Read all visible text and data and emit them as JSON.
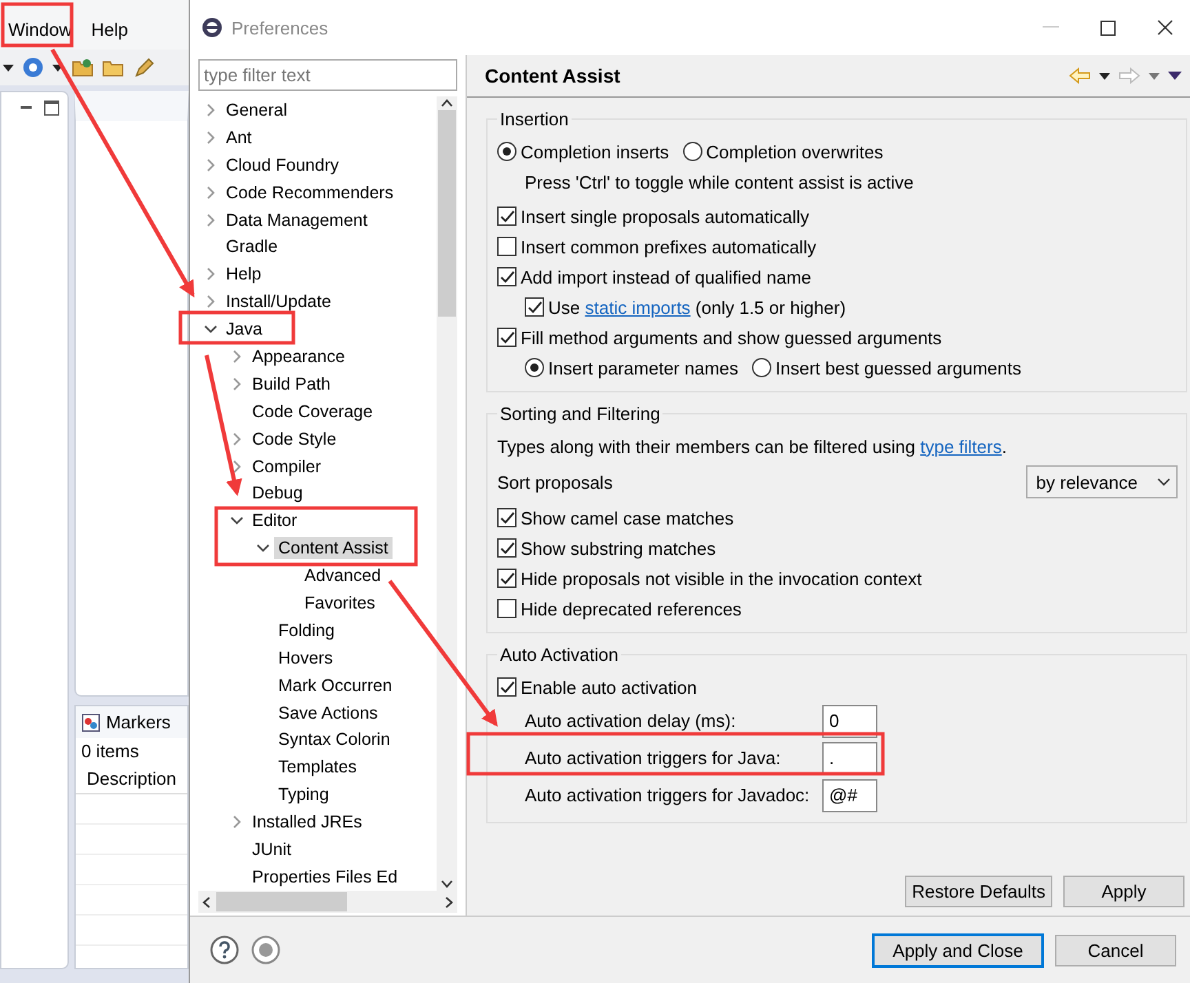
{
  "workbench": {
    "menu": [
      "Window",
      "Help"
    ],
    "markers_view": {
      "title": "Markers",
      "count": "0 items",
      "columns": [
        "Description"
      ]
    }
  },
  "dialog": {
    "title": "Preferences",
    "filter": {
      "placeholder": "type filter text"
    },
    "tree": [
      {
        "label": "General",
        "kind": "folder",
        "expanded": false,
        "selected": false
      },
      {
        "label": "Ant",
        "kind": "folder",
        "expanded": false,
        "selected": false
      },
      {
        "label": "Cloud Foundry",
        "kind": "folder",
        "expanded": false,
        "selected": false
      },
      {
        "label": "Code Recommenders",
        "kind": "folder",
        "expanded": false,
        "selected": false
      },
      {
        "label": "Data Management",
        "kind": "folder",
        "expanded": false,
        "selected": false
      },
      {
        "label": "Gradle",
        "kind": "leaf",
        "selected": false
      },
      {
        "label": "Help",
        "kind": "folder",
        "expanded": false,
        "selected": false
      },
      {
        "label": "Install/Update",
        "kind": "folder",
        "expanded": false,
        "selected": false
      },
      {
        "label": "Java",
        "kind": "folder",
        "expanded": true,
        "selected": false,
        "children": [
          {
            "label": "Appearance",
            "kind": "folder",
            "expanded": false,
            "selected": false
          },
          {
            "label": "Build Path",
            "kind": "folder",
            "expanded": false,
            "selected": false
          },
          {
            "label": "Code Coverage",
            "kind": "leaf",
            "selected": false
          },
          {
            "label": "Code Style",
            "kind": "folder",
            "expanded": false,
            "selected": false
          },
          {
            "label": "Compiler",
            "kind": "folder",
            "expanded": false,
            "selected": false
          },
          {
            "label": "Debug",
            "kind": "leaf",
            "selected": false
          },
          {
            "label": "Editor",
            "kind": "folder",
            "expanded": true,
            "selected": false,
            "children": [
              {
                "label": "Content Assist",
                "kind": "folder",
                "expanded": true,
                "selected": true,
                "children": [
                  {
                    "label": "Advanced",
                    "kind": "leaf",
                    "selected": false
                  },
                  {
                    "label": "Favorites",
                    "kind": "leaf",
                    "selected": false
                  }
                ]
              },
              {
                "label": "Folding",
                "kind": "leaf",
                "selected": false
              },
              {
                "label": "Hovers",
                "kind": "leaf",
                "selected": false
              },
              {
                "label": "Mark Occurren",
                "kind": "leaf",
                "selected": false
              },
              {
                "label": "Save Actions",
                "kind": "leaf",
                "selected": false
              },
              {
                "label": "Syntax Colorin",
                "kind": "leaf",
                "selected": false
              },
              {
                "label": "Templates",
                "kind": "leaf",
                "selected": false
              },
              {
                "label": "Typing",
                "kind": "leaf",
                "selected": false
              }
            ]
          },
          {
            "label": "Installed JREs",
            "kind": "folder",
            "expanded": false,
            "selected": false
          },
          {
            "label": "JUnit",
            "kind": "leaf",
            "selected": false
          },
          {
            "label": "Properties Files Ed",
            "kind": "leaf",
            "selected": false
          }
        ]
      }
    ],
    "page": {
      "title": "Content Assist",
      "groups": [
        {
          "title": "Insertion",
          "rows": [
            {
              "kind": "radios",
              "options": [
                {
                  "label": "Completion inserts",
                  "selected": true
                },
                {
                  "label": "Completion overwrites",
                  "selected": false
                }
              ],
              "hint": "Press 'Ctrl' to toggle while content assist is active"
            },
            {
              "kind": "checkbox",
              "label": "Insert single proposals automatically",
              "checked": true
            },
            {
              "kind": "checkbox",
              "label": "Insert common prefixes automatically",
              "checked": false
            },
            {
              "kind": "checkbox",
              "label": "Add import instead of qualified name",
              "checked": true,
              "children": [
                {
                  "kind": "checkbox",
                  "label": "Use ",
                  "link": "static imports",
                  "suffix": " (only 1.5 or higher)",
                  "checked": true
                }
              ]
            },
            {
              "kind": "checkbox",
              "label": "Fill method arguments and show guessed arguments",
              "checked": true,
              "children": [
                {
                  "kind": "radios",
                  "options": [
                    {
                      "label": "Insert parameter names",
                      "selected": true
                    },
                    {
                      "label": "Insert best guessed arguments",
                      "selected": false
                    }
                  ]
                }
              ]
            }
          ]
        },
        {
          "title": "Sorting and Filtering",
          "rows": [
            {
              "kind": "note",
              "text": "Types along with their members can be filtered using ",
              "link": "type filters",
              "suffix": "."
            },
            {
              "kind": "select",
              "label": "Sort proposals",
              "value": "by relevance"
            },
            {
              "kind": "checkbox",
              "label": "Show camel case matches",
              "checked": true
            },
            {
              "kind": "checkbox",
              "label": "Show substring matches",
              "checked": true
            },
            {
              "kind": "checkbox",
              "label": "Hide proposals not visible in the invocation context",
              "checked": true
            },
            {
              "kind": "checkbox",
              "label": "Hide deprecated references",
              "checked": false
            }
          ]
        },
        {
          "title": "Auto Activation",
          "rows": [
            {
              "kind": "checkbox",
              "label": "Enable auto activation",
              "checked": true,
              "children": [
                {
                  "kind": "field",
                  "label": "Auto activation delay (ms):",
                  "value": "0"
                },
                {
                  "kind": "field",
                  "label": "Auto activation triggers for Java:",
                  "value": "."
                },
                {
                  "kind": "field",
                  "label": "Auto activation triggers for Javadoc:",
                  "value": "@#"
                }
              ]
            }
          ]
        }
      ],
      "buttons": [
        "Restore Defaults",
        "Apply"
      ]
    },
    "buttons": [
      {
        "label": "Apply and Close",
        "default": true
      },
      {
        "label": "Cancel",
        "default": false
      }
    ]
  }
}
